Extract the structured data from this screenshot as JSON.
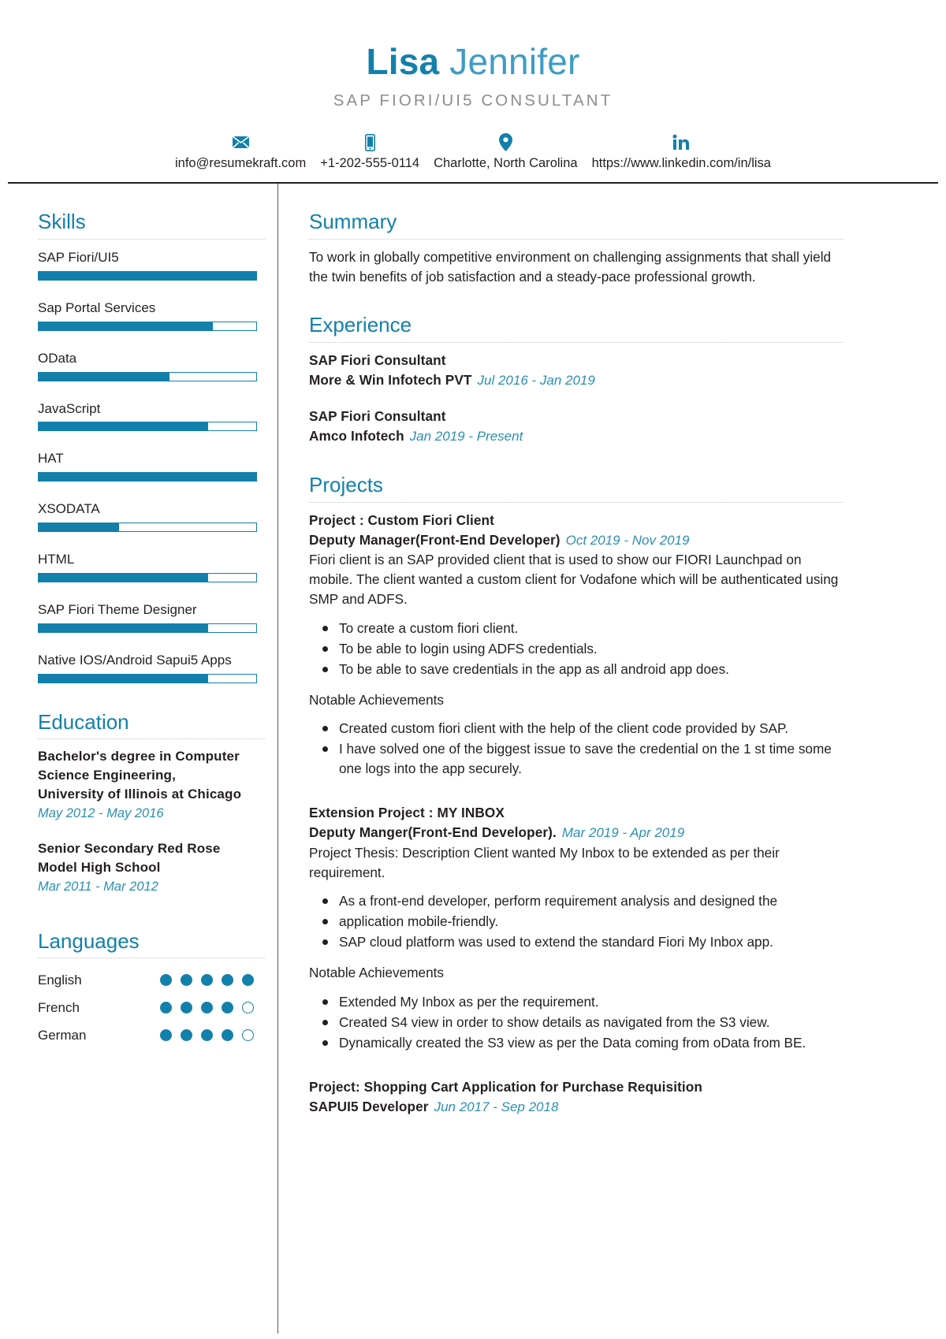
{
  "header": {
    "first_name": "Lisa",
    "last_name": "Jennifer",
    "role": "SAP FIORI/UI5 CONSULTANT",
    "accent_color": "#1380ab"
  },
  "contact": [
    {
      "icon": "envelope-icon",
      "text": "info@resumekraft.com"
    },
    {
      "icon": "phone-icon",
      "text": "+1-202-555-0114"
    },
    {
      "icon": "location-pin-icon",
      "text": "Charlotte, North Carolina"
    },
    {
      "icon": "linkedin-icon",
      "text": "https://www.linkedin.com/in/lisa"
    }
  ],
  "sidebar": {
    "skills": {
      "title": "Skills",
      "items": [
        {
          "name": "SAP Fiori/UI5",
          "level": 100
        },
        {
          "name": "Sap Portal Services",
          "level": 80
        },
        {
          "name": "OData",
          "level": 60
        },
        {
          "name": "JavaScript",
          "level": 78
        },
        {
          "name": "HAT",
          "level": 100
        },
        {
          "name": "XSODATA",
          "level": 37
        },
        {
          "name": "HTML",
          "level": 78
        },
        {
          "name": "SAP Fiori Theme Designer",
          "level": 78
        },
        {
          "name": "Native IOS/Android Sapui5 Apps",
          "level": 78
        }
      ]
    },
    "education": {
      "title": "Education",
      "items": [
        {
          "degree": "Bachelor's degree in Computer Science Engineering, University of Illinois at Chicago",
          "date": "May 2012 - May 2016"
        },
        {
          "degree": "Senior Secondary Red Rose Model High School",
          "date": "Mar 2011 - Mar 2012"
        }
      ]
    },
    "languages": {
      "title": "Languages",
      "scale": 5,
      "items": [
        {
          "name": "English",
          "level": 5
        },
        {
          "name": "French",
          "level": 4
        },
        {
          "name": "German",
          "level": 4
        }
      ]
    }
  },
  "main": {
    "summary": {
      "title": "Summary",
      "text": "To work in globally competitive environment on challenging assignments that shall yield the twin benefits of job satisfaction and a steady-pace professional growth."
    },
    "experience": {
      "title": "Experience",
      "items": [
        {
          "role": "SAP Fiori Consultant",
          "company": "More & Win Infotech PVT",
          "date": "Jul 2016 - Jan 2019"
        },
        {
          "role": "SAP Fiori Consultant",
          "company": "Amco Infotech",
          "date": "Jan 2019 - Present"
        }
      ]
    },
    "projects": {
      "title": "Projects",
      "items": [
        {
          "name": "Project : Custom Fiori Client",
          "role": "Deputy Manager(Front-End Developer)",
          "date": "Oct 2019 - Nov 2019",
          "description": "Fiori client is an SAP provided client that is used to show our FIORI Launchpad on mobile. The client wanted a custom client for Vodafone which will be authenticated using SMP and ADFS.",
          "bullets": [
            "To create a custom fiori client.",
            "To be able to login using ADFS credentials.",
            "To be able to save credentials in the app as all android app does."
          ],
          "notable_label": "Notable Achievements",
          "notable": [
            "Created custom fiori client with the help of the client code provided by SAP.",
            "I have solved one of the biggest issue to save the credential on the 1 st time some one logs into the app securely."
          ]
        },
        {
          "name": "Extension Project : MY INBOX",
          "role": "Deputy Manger(Front-End Developer).",
          "date": "Mar 2019 - Apr 2019",
          "description": "Project Thesis: Description Client wanted My Inbox to be extended as per their requirement.",
          "bullets": [
            "As a front-end developer, perform requirement analysis and designed the",
            "application mobile-friendly.",
            "SAP cloud platform was used to extend the standard Fiori My Inbox app."
          ],
          "notable_label": "Notable Achievements",
          "notable": [
            "Extended My Inbox as per the requirement.",
            "Created S4 view in order to show details as navigated from the S3 view.",
            "Dynamically created the S3 view as per the Data coming from oData from BE."
          ]
        },
        {
          "name": "Project: Shopping Cart Application for Purchase Requisition",
          "role": "SAPUI5 Developer",
          "date": "Jun 2017 - Sep 2018",
          "description": "",
          "bullets": [],
          "notable_label": "",
          "notable": []
        }
      ]
    }
  }
}
